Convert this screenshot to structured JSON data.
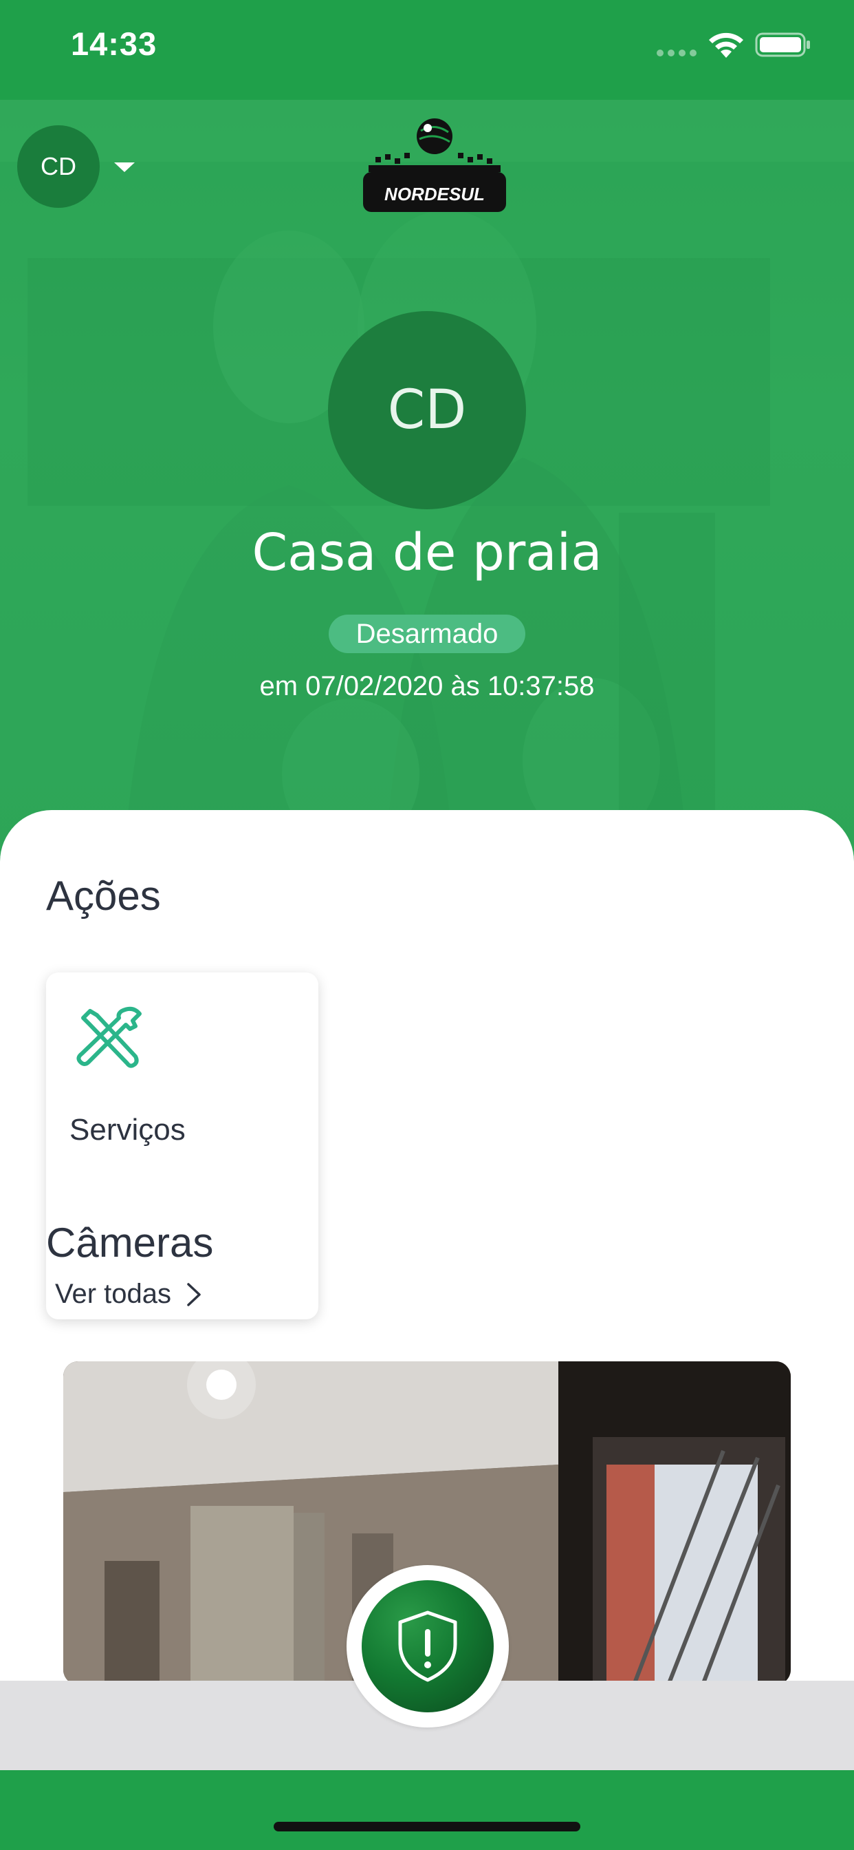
{
  "status_bar": {
    "time": "14:33"
  },
  "header": {
    "avatar_initials": "CD",
    "logo_text": "NORDESUL"
  },
  "profile": {
    "initials": "CD",
    "name": "Casa de praia",
    "status": "Desarmado",
    "status_time": "em 07/02/2020 às 10:37:58"
  },
  "actions": {
    "title": "Ações",
    "items": [
      {
        "label": "Serviços",
        "icon": "tools-icon"
      }
    ]
  },
  "cameras": {
    "title": "Câmeras",
    "see_all": "Ver todas"
  },
  "colors": {
    "primary": "#1fa04a",
    "accent": "#2bb58a",
    "text": "#2d3340",
    "badge": "#4cbc82"
  }
}
